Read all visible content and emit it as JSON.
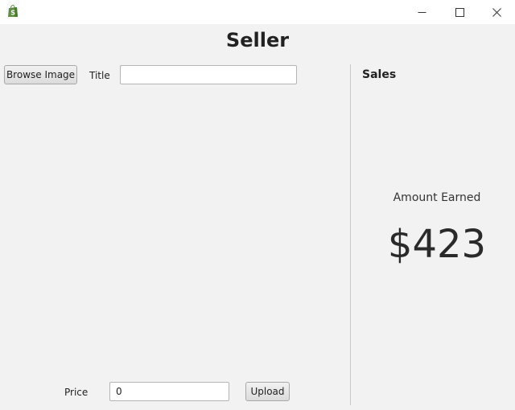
{
  "window": {
    "icons": {
      "app": "shopify-bag-icon",
      "minimize": "minimize-icon",
      "maximize": "maximize-icon",
      "close": "close-icon"
    },
    "colors": {
      "app_icon": "#5e8e3e",
      "titlebar": "#ffffff",
      "background": "#f2f2f2"
    }
  },
  "header": {
    "title": "Seller"
  },
  "form": {
    "browse_label": "Browse Image",
    "title_label": "Title",
    "title_value": "",
    "price_label": "Price",
    "price_value": "0",
    "upload_label": "Upload"
  },
  "sales": {
    "heading": "Sales",
    "amount_label": "Amount Earned",
    "amount_value": "$423"
  }
}
